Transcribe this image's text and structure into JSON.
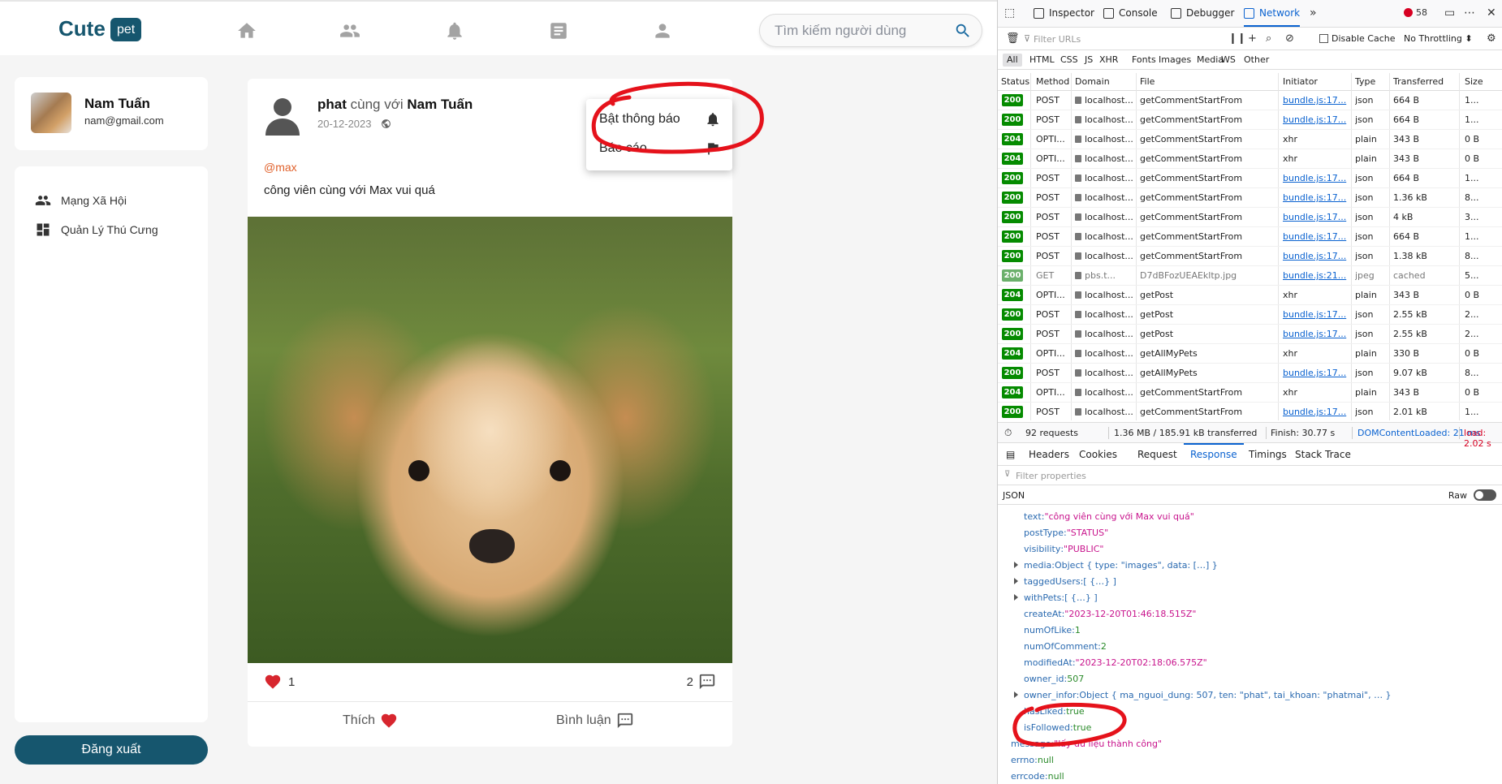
{
  "app": {
    "logo_text": "Cute",
    "logo_badge": "pet",
    "nav_icons": [
      "home-icon",
      "friends-icon",
      "bell-icon",
      "article-icon",
      "person-icon"
    ],
    "search_placeholder": "Tìm kiếm người dùng",
    "profile": {
      "name": "Nam Tuấn",
      "email": "nam@gmail.com"
    },
    "menu": [
      {
        "label": "Mạng Xã Hội",
        "icon": "people-icon"
      },
      {
        "label": "Quản Lý Thú Cưng",
        "icon": "dashboard-icon"
      }
    ],
    "logout_label": "Đăng xuất",
    "post": {
      "author": "phat",
      "with_text": "cùng với",
      "with_user": "Nam Tuấn",
      "date": "20-12-2023",
      "mention": "@max",
      "text": "công viên cùng với Max vui quá",
      "like_count": "1",
      "comment_count": "2",
      "like_label": "Thích",
      "comment_label": "Bình luận"
    },
    "popup": {
      "items": [
        {
          "label": "Bật thông báo",
          "icon": "bell-icon"
        },
        {
          "label": "Báo cáo",
          "icon": "flag-icon"
        }
      ]
    },
    "colors": {
      "brand": "#16566e",
      "like": "#d7262e",
      "mention": "#e0602a",
      "annotation": "#e5121b"
    }
  },
  "devtools": {
    "tabs": [
      "Inspector",
      "Console",
      "Debugger",
      "Network"
    ],
    "active_tab": "Network",
    "error_count": "58",
    "filter_placeholder": "Filter URLs",
    "disable_cache_label": "Disable Cache",
    "throttling": "No Throttling ⬍",
    "type_filters": [
      "All",
      "HTML",
      "CSS",
      "JS",
      "XHR",
      "Fonts",
      "Images",
      "Media",
      "WS",
      "Other"
    ],
    "columns": [
      "Status",
      "Method",
      "Domain",
      "File",
      "Initiator",
      "Type",
      "Transferred",
      "Size"
    ],
    "rows": [
      {
        "status": "200",
        "method": "POST",
        "domain": "localhost...",
        "file": "getCommentStartFrom",
        "initiator": "bundle.js:17...",
        "type": "json",
        "transferred": "664 B",
        "size": "1..."
      },
      {
        "status": "200",
        "method": "POST",
        "domain": "localhost...",
        "file": "getCommentStartFrom",
        "initiator": "bundle.js:17...",
        "type": "json",
        "transferred": "664 B",
        "size": "1..."
      },
      {
        "status": "204",
        "method": "OPTI...",
        "domain": "localhost...",
        "file": "getCommentStartFrom",
        "initiator": "xhr",
        "type": "plain",
        "transferred": "343 B",
        "size": "0 B"
      },
      {
        "status": "204",
        "method": "OPTI...",
        "domain": "localhost...",
        "file": "getCommentStartFrom",
        "initiator": "xhr",
        "type": "plain",
        "transferred": "343 B",
        "size": "0 B"
      },
      {
        "status": "200",
        "method": "POST",
        "domain": "localhost...",
        "file": "getCommentStartFrom",
        "initiator": "bundle.js:17...",
        "type": "json",
        "transferred": "664 B",
        "size": "1..."
      },
      {
        "status": "200",
        "method": "POST",
        "domain": "localhost...",
        "file": "getCommentStartFrom",
        "initiator": "bundle.js:17...",
        "type": "json",
        "transferred": "1.36 kB",
        "size": "8..."
      },
      {
        "status": "200",
        "method": "POST",
        "domain": "localhost...",
        "file": "getCommentStartFrom",
        "initiator": "bundle.js:17...",
        "type": "json",
        "transferred": "4 kB",
        "size": "3..."
      },
      {
        "status": "200",
        "method": "POST",
        "domain": "localhost...",
        "file": "getCommentStartFrom",
        "initiator": "bundle.js:17...",
        "type": "json",
        "transferred": "664 B",
        "size": "1..."
      },
      {
        "status": "200",
        "method": "POST",
        "domain": "localhost...",
        "file": "getCommentStartFrom",
        "initiator": "bundle.js:17...",
        "type": "json",
        "transferred": "1.38 kB",
        "size": "8..."
      },
      {
        "status": "200",
        "method": "GET",
        "domain": "pbs.t...",
        "file": "D7dBFozUEAEkltp.jpg",
        "initiator": "bundle.js:21...",
        "type": "jpeg",
        "transferred": "cached",
        "size": "5...",
        "cached": true
      },
      {
        "status": "204",
        "method": "OPTI...",
        "domain": "localhost...",
        "file": "getPost",
        "initiator": "xhr",
        "type": "plain",
        "transferred": "343 B",
        "size": "0 B"
      },
      {
        "status": "200",
        "method": "POST",
        "domain": "localhost...",
        "file": "getPost",
        "initiator": "bundle.js:17...",
        "type": "json",
        "transferred": "2.55 kB",
        "size": "2..."
      },
      {
        "status": "200",
        "method": "POST",
        "domain": "localhost...",
        "file": "getPost",
        "initiator": "bundle.js:17...",
        "type": "json",
        "transferred": "2.55 kB",
        "size": "2..."
      },
      {
        "status": "204",
        "method": "OPTI...",
        "domain": "localhost...",
        "file": "getAllMyPets",
        "initiator": "xhr",
        "type": "plain",
        "transferred": "330 B",
        "size": "0 B"
      },
      {
        "status": "200",
        "method": "POST",
        "domain": "localhost...",
        "file": "getAllMyPets",
        "initiator": "bundle.js:17...",
        "type": "json",
        "transferred": "9.07 kB",
        "size": "8..."
      },
      {
        "status": "204",
        "method": "OPTI...",
        "domain": "localhost...",
        "file": "getCommentStartFrom",
        "initiator": "xhr",
        "type": "plain",
        "transferred": "343 B",
        "size": "0 B"
      },
      {
        "status": "200",
        "method": "POST",
        "domain": "localhost...",
        "file": "getCommentStartFrom",
        "initiator": "bundle.js:17...",
        "type": "json",
        "transferred": "2.01 kB",
        "size": "1..."
      }
    ],
    "summary": {
      "requests": "92 requests",
      "transferred": "1.36 MB / 185.91 kB transferred",
      "finish": "Finish: 30.77 s",
      "dom_loaded": "DOMContentLoaded: 21 ms",
      "load": "load: 2.02 s"
    },
    "detail_tabs": [
      "Headers",
      "Cookies",
      "Request",
      "Response",
      "Timings",
      "Stack Trace"
    ],
    "active_detail_tab": "Response",
    "filter_props_placeholder": "Filter properties",
    "json_label": "JSON",
    "raw_label": "Raw",
    "json_lines": [
      {
        "key": "text",
        "value": "\"công viên cùng với Max vui quá\"",
        "kind": "s",
        "indent": 1,
        "expandable": false
      },
      {
        "key": "postType",
        "value": "\"STATUS\"",
        "kind": "s",
        "indent": 1,
        "expandable": false
      },
      {
        "key": "visibility",
        "value": "\"PUBLIC\"",
        "kind": "s",
        "indent": 1,
        "expandable": false
      },
      {
        "key": "media",
        "value": "Object { type: \"images\", data: […] }",
        "kind": "p",
        "indent": 1,
        "expandable": true
      },
      {
        "key": "taggedUsers",
        "value": "[ {…} ]",
        "kind": "p",
        "indent": 1,
        "expandable": true
      },
      {
        "key": "withPets",
        "value": "[ {…} ]",
        "kind": "p",
        "indent": 1,
        "expandable": true
      },
      {
        "key": "createAt",
        "value": "\"2023-12-20T01:46:18.515Z\"",
        "kind": "s",
        "indent": 1,
        "expandable": false
      },
      {
        "key": "numOfLike",
        "value": "1",
        "kind": "n",
        "indent": 1,
        "expandable": false
      },
      {
        "key": "numOfComment",
        "value": "2",
        "kind": "n",
        "indent": 1,
        "expandable": false
      },
      {
        "key": "modifiedAt",
        "value": "\"2023-12-20T02:18:06.575Z\"",
        "kind": "s",
        "indent": 1,
        "expandable": false
      },
      {
        "key": "owner_id",
        "value": "507",
        "kind": "n",
        "indent": 1,
        "expandable": false
      },
      {
        "key": "owner_infor",
        "value": "Object { ma_nguoi_dung: 507, ten: \"phat\", tai_khoan: \"phatmai\", … }",
        "kind": "p",
        "indent": 1,
        "expandable": true
      },
      {
        "key": "hasLiked",
        "value": "true",
        "kind": "n",
        "indent": 1,
        "expandable": false
      },
      {
        "key": "isFollowed",
        "value": "true",
        "kind": "n",
        "indent": 1,
        "expandable": false
      },
      {
        "key": "message",
        "value": "\"lấy dữ liệu thành công\"",
        "kind": "s",
        "indent": 0,
        "expandable": false
      },
      {
        "key": "errno",
        "value": "null",
        "kind": "n",
        "indent": 0,
        "expandable": false
      },
      {
        "key": "errcode",
        "value": "null",
        "kind": "n",
        "indent": 0,
        "expandable": false
      }
    ]
  }
}
